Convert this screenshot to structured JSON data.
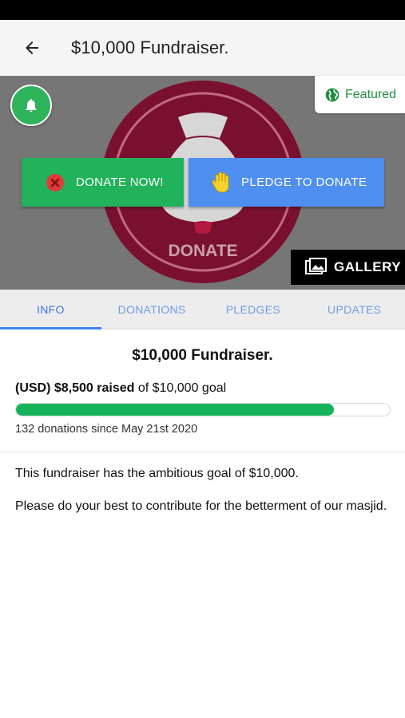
{
  "app_bar": {
    "title": "$10,000 Fundraiser."
  },
  "hero": {
    "logo_text": "DONATE",
    "featured_label": "Featured",
    "donate_label": "DONATE NOW!",
    "pledge_label": "PLEDGE TO DONATE",
    "gallery_label": "GALLERY",
    "icons": [
      "bell-icon",
      "globe-icon",
      "close-circle-icon",
      "hand-icon",
      "gallery-icon",
      "arrow-left-icon"
    ]
  },
  "tabs": [
    {
      "label": "INFO",
      "active": true
    },
    {
      "label": "DONATIONS",
      "active": false
    },
    {
      "label": "PLEDGES",
      "active": false
    },
    {
      "label": "UPDATES",
      "active": false
    }
  ],
  "summary": {
    "title": "$10,000 Fundraiser.",
    "raised_prefix": "(USD) $8,500 raised",
    "raised_suffix": " of $10,000 goal",
    "progress_fraction": 0.85,
    "donations_since": "132 donations since May 21st 2020"
  },
  "description": {
    "paragraph_1": "This fundraiser has the ambitious goal of $10,000.",
    "paragraph_2": "Please do your best to contribute for the betterment of our masjid."
  },
  "colors": {
    "accent_blue": "#3d84f0",
    "donate_green": "#21b25b",
    "progress_green": "#16b45a",
    "logo_maroon": "#8b0f2e"
  }
}
